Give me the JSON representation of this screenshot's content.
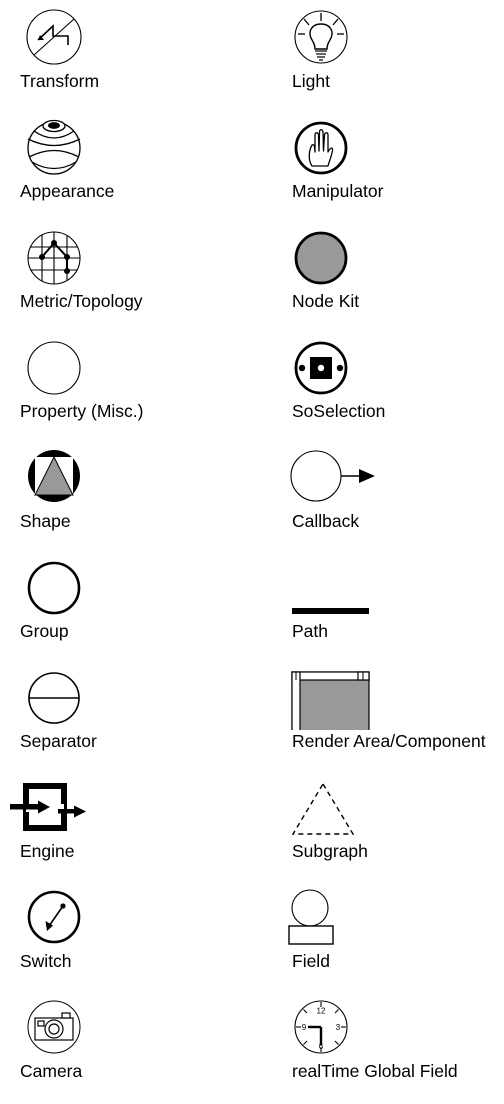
{
  "figure": {
    "kind": "icon-legend",
    "columns": 2,
    "rows": 10,
    "background": "#ffffff",
    "ink": "#000000",
    "fill_gray": "#999999"
  },
  "left_column": {
    "items": [
      {
        "label": "Transform",
        "icon": "transform-circle-zigzag-icon"
      },
      {
        "label": "Appearance",
        "icon": "appearance-sphere-icon"
      },
      {
        "label": "Metric/Topology",
        "icon": "metric-topology-grid-graph-icon"
      },
      {
        "label": "Property (Misc.)",
        "icon": "property-empty-circle-icon"
      },
      {
        "label": "Shape",
        "icon": "shape-filled-circle-triangle-icon"
      },
      {
        "label": "Group",
        "icon": "group-bold-circle-icon"
      },
      {
        "label": "Separator",
        "icon": "separator-circle-bisected-icon"
      },
      {
        "label": "Engine",
        "icon": "engine-box-arrows-icon"
      },
      {
        "label": "Switch",
        "icon": "switch-circle-arrow-icon"
      },
      {
        "label": "Camera",
        "icon": "camera-in-circle-icon"
      }
    ]
  },
  "right_column": {
    "items": [
      {
        "label": "Light",
        "icon": "light-bulb-rays-icon"
      },
      {
        "label": "Manipulator",
        "icon": "manipulator-hand-icon"
      },
      {
        "label": "Node Kit",
        "icon": "node-kit-gray-disc-icon"
      },
      {
        "label": "SoSelection",
        "icon": "soselection-square-dots-icon"
      },
      {
        "label": "Callback",
        "icon": "callback-circle-arrow-out-icon"
      },
      {
        "label": "Path",
        "icon": "path-thick-bar-icon"
      },
      {
        "label": "Render Area/Component",
        "icon": "render-area-window-icon"
      },
      {
        "label": "Subgraph",
        "icon": "subgraph-dashed-triangle-icon"
      },
      {
        "label": "Field",
        "icon": "field-circle-rect-icon"
      },
      {
        "label": "realTime Global Field",
        "icon": "realtime-clock-icon"
      }
    ]
  },
  "clock": {
    "numerals": [
      "12",
      "3",
      "6",
      "9"
    ]
  }
}
